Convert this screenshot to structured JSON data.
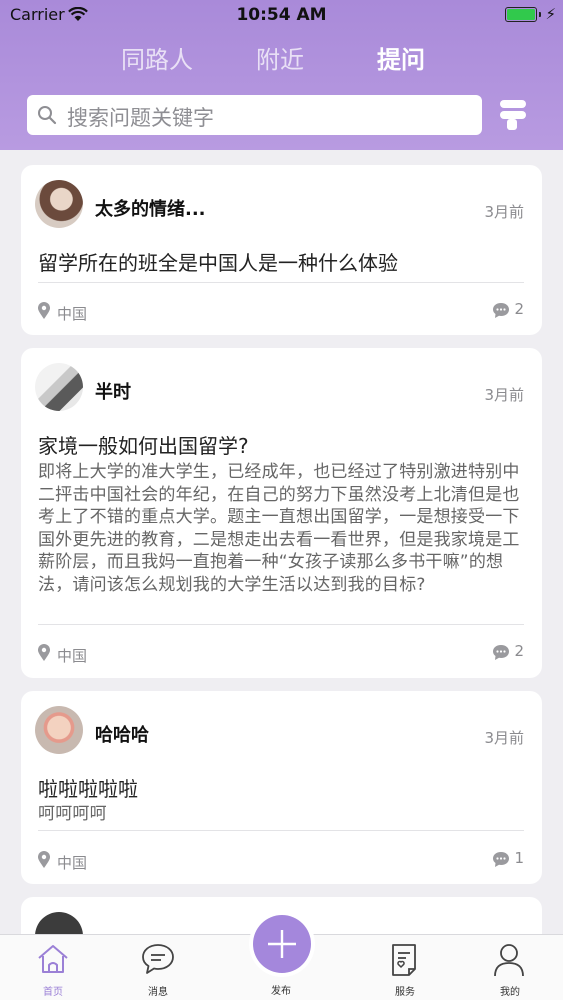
{
  "status_bar": {
    "carrier": "Carrier",
    "time": "10:54 AM",
    "battery_level": 1.0
  },
  "top_tabs": [
    {
      "label": "同路人",
      "active": false
    },
    {
      "label": "附近",
      "active": false
    },
    {
      "label": "提问",
      "active": true
    }
  ],
  "search": {
    "placeholder": "搜索问题关键字",
    "icon": "search-icon",
    "filter_icon": "filter-icon"
  },
  "posts": [
    {
      "name": "太多的情绪...",
      "date": "3月前",
      "title": "留学所在的班全是中国人是一种什么体验",
      "body": "",
      "location": "中国",
      "comments": "2"
    },
    {
      "name": "半时",
      "date": "3月前",
      "title": "家境一般如何出国留学?",
      "body": "即将上大学的准大学生，已经成年，也已经过了特别激进特别中二抨击中国社会的年纪，在自己的努力下虽然没考上北清但是也考上了不错的重点大学。题主一直想出国留学，一是想接受一下国外更先进的教育，二是想走出去看一看世界，但是我家境是工薪阶层，而且我妈一直抱着一种“女孩子读那么多书干嘛”的想法，请问该怎么规划我的大学生活以达到我的目标?",
      "location": "中国",
      "comments": "2"
    },
    {
      "name": "哈哈哈",
      "date": "3月前",
      "title": "啦啦啦啦啦",
      "body": "呵呵呵呵",
      "location": "中国",
      "comments": "1"
    },
    {
      "name": "...",
      "date": "",
      "title": "",
      "body": "",
      "location": "",
      "comments": ""
    }
  ],
  "tabbar": [
    {
      "label": "首页",
      "icon": "home-icon",
      "active": true
    },
    {
      "label": "消息",
      "icon": "message-icon",
      "active": false
    },
    {
      "label": "发布",
      "icon": "plus-icon",
      "active": false
    },
    {
      "label": "服务",
      "icon": "service-icon",
      "active": false
    },
    {
      "label": "我的",
      "icon": "profile-icon",
      "active": false
    }
  ],
  "colors": {
    "brand_purple": "#a487dc",
    "header_gradient_top": "#a98ad9",
    "header_gradient_bottom": "#b89be1",
    "active_tab_label": "#9b80d6",
    "battery_green": "#31c94c"
  }
}
